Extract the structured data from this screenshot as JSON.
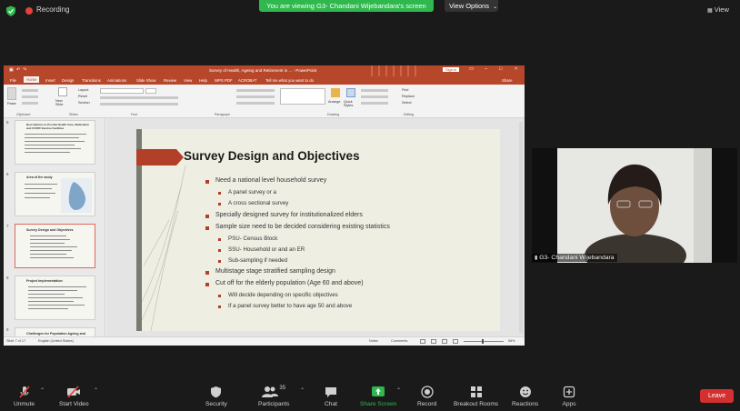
{
  "top": {
    "recording": "Recording",
    "viewing": "You are viewing G3- Chandani Wijebandara's screen",
    "view_options": "View Options",
    "view": "View"
  },
  "ppt": {
    "title": "Survey of Health, Ageing and Retirement in ... - PowerPoint",
    "sign_in": "Sign in",
    "menu": [
      "File",
      "Home",
      "Insert",
      "Design",
      "Transitions",
      "Animations",
      "Slide Show",
      "Review",
      "View",
      "Help",
      "WPS PDF",
      "ACROBAT",
      "Tell me what you want to do"
    ],
    "share": "Share",
    "ribbon_groups": [
      "Clipboard",
      "Slides",
      "Font",
      "Paragraph",
      "Drawing",
      "Editing"
    ],
    "ribbon_labels": {
      "paste": "Paste",
      "new_slide": "New Slide",
      "layout": "Layout",
      "reset": "Reset",
      "section": "Section",
      "arrange": "Arrange",
      "quick_styles": "Quick Styles",
      "find": "Find",
      "replace": "Replace",
      "select": "Select"
    },
    "status_left": "Slide 7 of 17",
    "status_lang": "English (United States)",
    "status_notes": "Notes",
    "status_comments": "Comments",
    "zoom": "56%"
  },
  "thumbs": [
    {
      "num": "5",
      "title": "Best Options to Provide Health Care, Medication and COVID Vaccine Facilities"
    },
    {
      "num": "6",
      "title": "Area of the study"
    },
    {
      "num": "7",
      "title": "Survey Design and Objectives"
    },
    {
      "num": "8",
      "title": "Project Implementation"
    },
    {
      "num": "9",
      "title": "Challenges for Population Ageing and"
    }
  ],
  "slide": {
    "title": "Survey Design and Objectives",
    "bullets": [
      {
        "level": 1,
        "text": "Need a national level household survey"
      },
      {
        "level": 2,
        "text": "A panel survey or a"
      },
      {
        "level": 2,
        "text": "A cross sectional survey"
      },
      {
        "level": 1,
        "text": "Specially designed survey for institutionalized elders"
      },
      {
        "level": 1,
        "text": "Sample size need to be decided considering existing statistics"
      },
      {
        "level": 2,
        "text": "PSU- Census Block"
      },
      {
        "level": 2,
        "text": "SSU- Household or and an ER"
      },
      {
        "level": 2,
        "text": "Sub-sampling if needed"
      },
      {
        "level": 1,
        "text": "Multistage stage stratified sampling design"
      },
      {
        "level": 1,
        "text": "Cut off for the elderly population (Age 60 and above)"
      },
      {
        "level": 2,
        "text": "Will decide depending on specific objectives"
      },
      {
        "level": 2,
        "text": "If a panel survey better to have age 50 and above"
      }
    ]
  },
  "video": {
    "name": "G3- Chandani Wijebandara"
  },
  "controls": {
    "unmute": "Unmute",
    "start_video": "Start Video",
    "security": "Security",
    "participants": "Participants",
    "participant_count": "35",
    "chat": "Chat",
    "share_screen": "Share Screen",
    "record": "Record",
    "breakout": "Breakout Rooms",
    "reactions": "Reactions",
    "apps": "Apps",
    "leave": "Leave"
  },
  "colors": {
    "accent_green": "#2fb84d",
    "ppt_red": "#b7472a",
    "leave_red": "#d3302f",
    "bullet_red": "#b24028"
  }
}
